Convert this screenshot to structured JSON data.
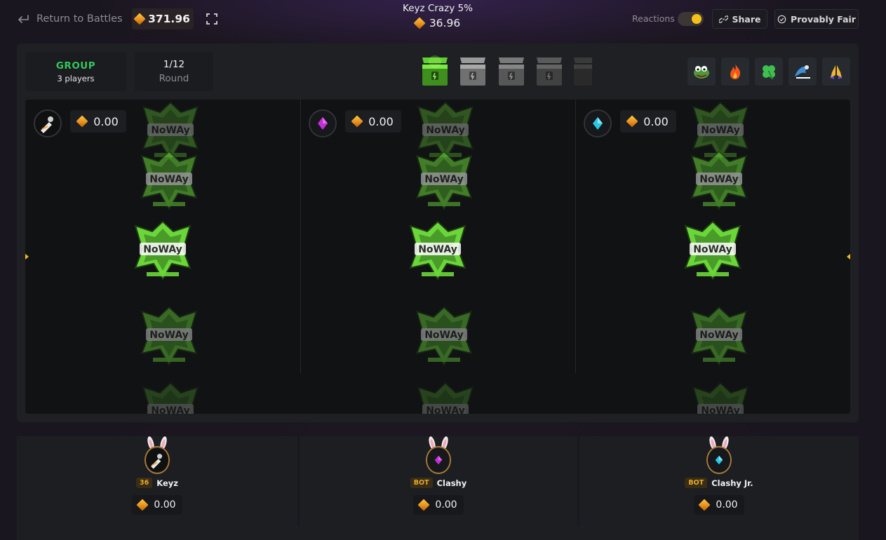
{
  "header": {
    "back_label": "Return to Battles",
    "balance": "371.96",
    "battle_title": "Keyz Crazy 5%",
    "battle_cost": "36.96",
    "reactions_label": "Reactions",
    "reactions_enabled": true,
    "share_label": "Share",
    "fair_label": "Provably Fair"
  },
  "status": {
    "mode": "GROUP",
    "players": "3 players",
    "round_count": "1/12",
    "round_label": "Round"
  },
  "cases": [
    {
      "state": "active",
      "color": "#6bd63a"
    },
    {
      "state": "upcoming",
      "color": "#8a8a8a"
    },
    {
      "state": "upcoming",
      "color": "#6a6a6a"
    },
    {
      "state": "upcoming",
      "color": "#4e4e4e"
    },
    {
      "state": "upcoming",
      "color": "#333333"
    }
  ],
  "reactions": [
    {
      "name": "pepe-reaction-icon"
    },
    {
      "name": "fire-reaction-icon"
    },
    {
      "name": "clover-reaction-icon"
    },
    {
      "name": "wave-reaction-icon"
    },
    {
      "name": "pray-reaction-icon"
    }
  ],
  "lanes": [
    {
      "player": "Keyz",
      "amount": "0.00"
    },
    {
      "player": "Clashy",
      "amount": "0.00",
      "gem_color": "#c32ed6"
    },
    {
      "player": "Clashy Jr.",
      "amount": "0.00",
      "gem_color": "#29c7e6"
    }
  ],
  "players": [
    {
      "badge": "36",
      "name": "Keyz",
      "amount": "0.00"
    },
    {
      "badge": "BOT",
      "name": "Clashy",
      "amount": "0.00",
      "gem_color": "#c32ed6"
    },
    {
      "badge": "BOT",
      "name": "Clashy Jr.",
      "amount": "0.00",
      "gem_color": "#29c7e6"
    }
  ],
  "colors": {
    "accent_gold": "#f6c01b",
    "mode_green": "#33c759",
    "item_green": "#6bd63a"
  }
}
